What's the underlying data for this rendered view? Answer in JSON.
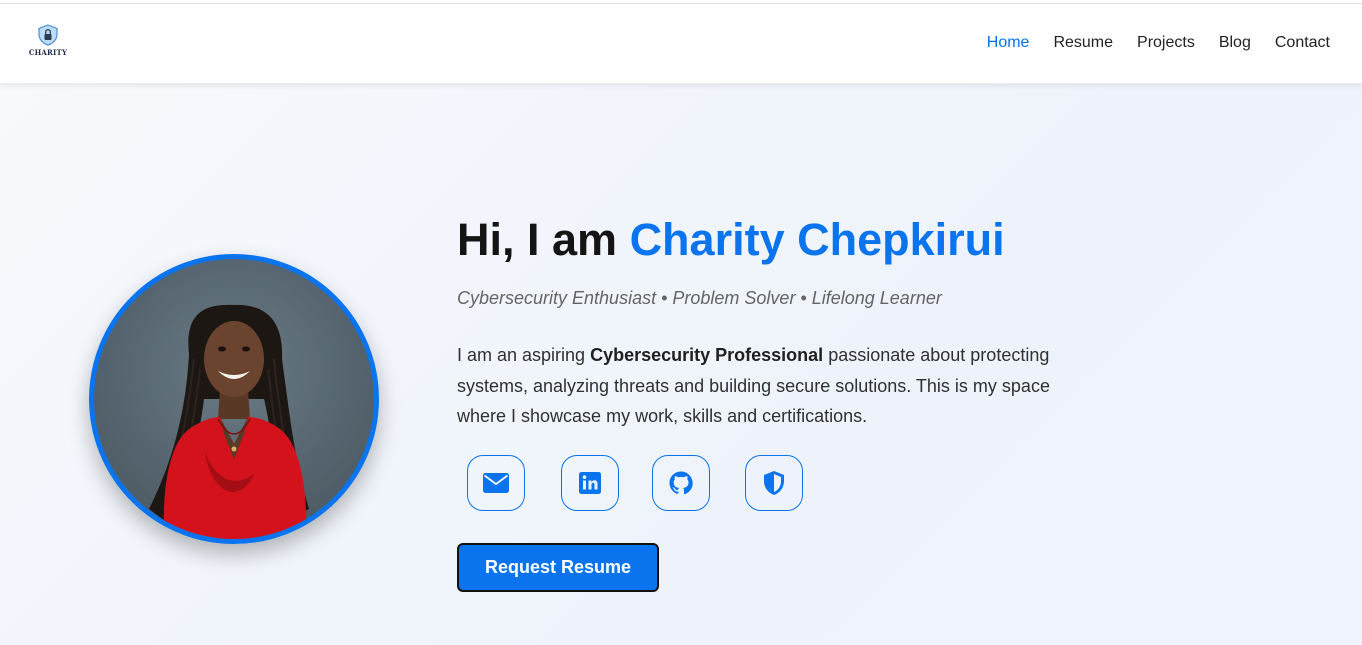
{
  "header": {
    "logo_text": "CHARITY",
    "nav": [
      {
        "label": "Home",
        "active": true
      },
      {
        "label": "Resume",
        "active": false
      },
      {
        "label": "Projects",
        "active": false
      },
      {
        "label": "Blog",
        "active": false
      },
      {
        "label": "Contact",
        "active": false
      }
    ]
  },
  "hero": {
    "greeting": "Hi, I am ",
    "name": "Charity Chepkirui",
    "subtitle": "Cybersecurity Enthusiast • Problem Solver • Lifelong Learner",
    "intro_part1": "I am an aspiring ",
    "intro_bold": "Cybersecurity Professional",
    "intro_part2": " passionate about protecting systems, analyzing threats and building secure solutions. This is my space where I showcase my work, skills and certifications.",
    "socials": [
      {
        "icon": "envelope-icon"
      },
      {
        "icon": "linkedin-icon"
      },
      {
        "icon": "github-icon"
      },
      {
        "icon": "shield-icon"
      }
    ],
    "button_label": "Request Resume"
  },
  "colors": {
    "accent": "#0a74ee",
    "text": "#141414",
    "muted": "#646464"
  }
}
